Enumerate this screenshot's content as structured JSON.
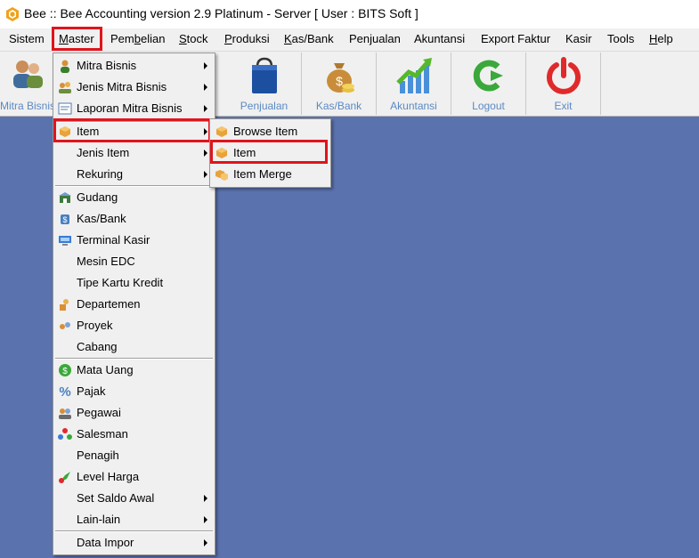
{
  "window": {
    "title": "Bee :: Bee Accounting version 2.9 Platinum - Server  [ User : BITS Soft ]"
  },
  "menubar": {
    "items": [
      {
        "label": "Sistem",
        "key": "y"
      },
      {
        "label": "Master",
        "key": "M"
      },
      {
        "label": "Pembelian",
        "key": "b"
      },
      {
        "label": "Stock",
        "key": "S"
      },
      {
        "label": "Produksi",
        "key": "P"
      },
      {
        "label": "Kas/Bank",
        "key": "K"
      },
      {
        "label": "Penjualan",
        "key": ""
      },
      {
        "label": "Akuntansi",
        "key": ""
      },
      {
        "label": "Export Faktur",
        "key": ""
      },
      {
        "label": "Kasir",
        "key": ""
      },
      {
        "label": "Tools",
        "key": ""
      },
      {
        "label": "Help",
        "key": "H"
      }
    ]
  },
  "toolbar": {
    "buttons": [
      {
        "label": "Mitra Bisnis",
        "icon": "users-icon"
      },
      {
        "label": "Penjualan",
        "icon": "shopping-bag-icon"
      },
      {
        "label": "Kas/Bank",
        "icon": "money-bag-icon"
      },
      {
        "label": "Akuntansi",
        "icon": "chart-icon"
      },
      {
        "label": "Logout",
        "icon": "logout-icon"
      },
      {
        "label": "Exit",
        "icon": "power-icon"
      }
    ]
  },
  "master_menu": {
    "items": [
      {
        "label": "Mitra Bisnis",
        "icon": "person-icon",
        "submenu": true
      },
      {
        "label": "Jenis Mitra Bisnis",
        "icon": "people-icon",
        "submenu": true
      },
      {
        "label": "Laporan Mitra Bisnis",
        "icon": "report-icon",
        "submenu": true
      },
      {
        "label": "Item",
        "icon": "box-icon",
        "submenu": true
      },
      {
        "label": "Jenis Item",
        "icon": "",
        "submenu": true
      },
      {
        "label": "Rekuring",
        "icon": "",
        "submenu": true
      },
      {
        "label": "Gudang",
        "icon": "warehouse-icon",
        "submenu": false
      },
      {
        "label": "Kas/Bank",
        "icon": "bank-icon",
        "submenu": false
      },
      {
        "label": "Terminal Kasir",
        "icon": "terminal-icon",
        "submenu": false
      },
      {
        "label": "Mesin EDC",
        "icon": "",
        "submenu": false
      },
      {
        "label": "Tipe Kartu Kredit",
        "icon": "",
        "submenu": false
      },
      {
        "label": "Departemen",
        "icon": "department-icon",
        "submenu": false
      },
      {
        "label": "Proyek",
        "icon": "project-icon",
        "submenu": false
      },
      {
        "label": "Cabang",
        "icon": "",
        "submenu": false
      },
      {
        "label": "Mata Uang",
        "icon": "currency-icon",
        "submenu": false
      },
      {
        "label": "Pajak",
        "icon": "percent-icon",
        "submenu": false
      },
      {
        "label": "Pegawai",
        "icon": "employee-icon",
        "submenu": false
      },
      {
        "label": "Salesman",
        "icon": "salesman-icon",
        "submenu": false
      },
      {
        "label": "Penagih",
        "icon": "",
        "submenu": false
      },
      {
        "label": "Level Harga",
        "icon": "price-level-icon",
        "submenu": false
      },
      {
        "label": "Set Saldo Awal",
        "icon": "",
        "submenu": true
      },
      {
        "label": "Lain-lain",
        "icon": "",
        "submenu": true
      },
      {
        "label": "Data Impor",
        "icon": "",
        "submenu": true
      }
    ]
  },
  "item_submenu": {
    "items": [
      {
        "label": "Browse Item",
        "icon": "box-icon"
      },
      {
        "label": "Item",
        "icon": "box-icon"
      },
      {
        "label": "Item Merge",
        "icon": "box-merge-icon"
      }
    ]
  },
  "colors": {
    "desktop": "#5a72ae",
    "highlight": "#e0141c",
    "toolbar_label": "#5b8ac3",
    "menu_bg": "#f0f0f0"
  }
}
